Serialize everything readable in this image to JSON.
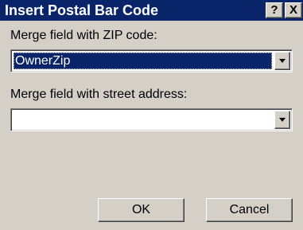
{
  "dialog": {
    "title": "Insert Postal Bar Code",
    "help_button_label": "?",
    "close_button_label": "X"
  },
  "zip_field": {
    "label": "Merge field with ZIP code:",
    "selected_value": "OwnerZip"
  },
  "street_field": {
    "label": "Merge field with street address:",
    "selected_value": ""
  },
  "buttons": {
    "ok_label": "OK",
    "cancel_label": "Cancel"
  },
  "colors": {
    "title_bar": "#0a246a",
    "dialog_face": "#d4d0c8",
    "selection": "#0a246a"
  }
}
